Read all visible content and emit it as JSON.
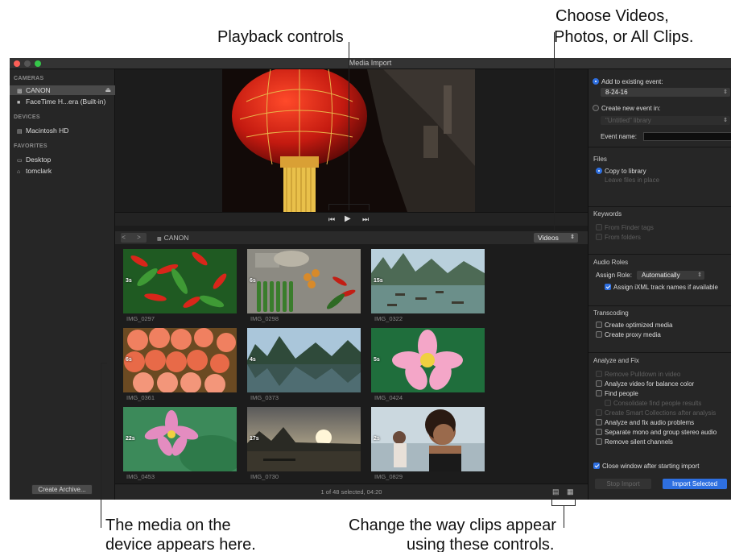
{
  "callouts": {
    "playback": "Playback controls",
    "choose_line1": "Choose Videos,",
    "choose_line2": "Photos, or All Clips.",
    "media_line1": "The media on the",
    "media_line2": "device appears here.",
    "change_line1": "Change the way clips appear",
    "change_line2": "using these controls."
  },
  "window": {
    "title": "Media Import"
  },
  "sidebar": {
    "cameras_header": "CAMERAS",
    "cameras": [
      {
        "label": "CANON",
        "icon": "camera-icon",
        "selected": true
      },
      {
        "label": "FaceTime H...era (Built-in)",
        "icon": "video-camera-icon",
        "selected": false
      }
    ],
    "devices_header": "DEVICES",
    "devices": [
      {
        "label": "Macintosh HD",
        "icon": "hard-drive-icon"
      }
    ],
    "favorites_header": "FAVORITES",
    "favorites": [
      {
        "label": "Desktop",
        "icon": "desktop-icon"
      },
      {
        "label": "tomclark",
        "icon": "home-icon"
      }
    ],
    "create_archive": "Create Archive..."
  },
  "browser": {
    "nav": "< >",
    "breadcrumb": "CANON",
    "filter_value": "Videos",
    "clips": [
      {
        "name": "IMG_0297",
        "duration": "3s"
      },
      {
        "name": "IMG_0298",
        "duration": "6s"
      },
      {
        "name": "IMG_0322",
        "duration": "15s"
      },
      {
        "name": "IMG_0361",
        "duration": "6s"
      },
      {
        "name": "IMG_0373",
        "duration": "4s"
      },
      {
        "name": "IMG_0424",
        "duration": "5s"
      },
      {
        "name": "IMG_0453",
        "duration": "22s"
      },
      {
        "name": "IMG_0730",
        "duration": "17s"
      },
      {
        "name": "IMG_0829",
        "duration": "2s"
      }
    ],
    "status": "1 of 48 selected, 04:20"
  },
  "import_options": {
    "add_existing_label": "Add to existing event:",
    "add_existing_value": "8-24-16",
    "create_new_label": "Create new event in:",
    "create_new_value": "\"Untitled\" library",
    "event_name_label": "Event name:",
    "files_header": "Files",
    "copy_to_library": "Copy to library",
    "leave_in_place": "Leave files in place",
    "keywords_header": "Keywords",
    "from_finder_tags": "From Finder tags",
    "from_folders": "From folders",
    "audio_roles_header": "Audio Roles",
    "assign_role_label": "Assign Role:",
    "assign_role_value": "Automatically",
    "assign_ixml": "Assign iXML track names if available",
    "transcoding_header": "Transcoding",
    "optimized_media": "Create optimized media",
    "proxy_media": "Create proxy media",
    "analyze_header": "Analyze and Fix",
    "remove_pulldown": "Remove Pulldown in video",
    "analyze_balance": "Analyze video for balance color",
    "find_people": "Find people",
    "consolidate_people": "Consolidate find people results",
    "smart_collections": "Create Smart Collections after analysis",
    "analyze_audio": "Analyze and fix audio problems",
    "separate_mono": "Separate mono and group stereo audio",
    "remove_silent": "Remove silent channels",
    "close_window": "Close window after starting import",
    "stop_import": "Stop Import",
    "import_selected": "Import Selected"
  },
  "colors": {
    "accent": "#2e6fe0",
    "window_bg": "#1e1e1e",
    "panel_bg": "#262626"
  }
}
